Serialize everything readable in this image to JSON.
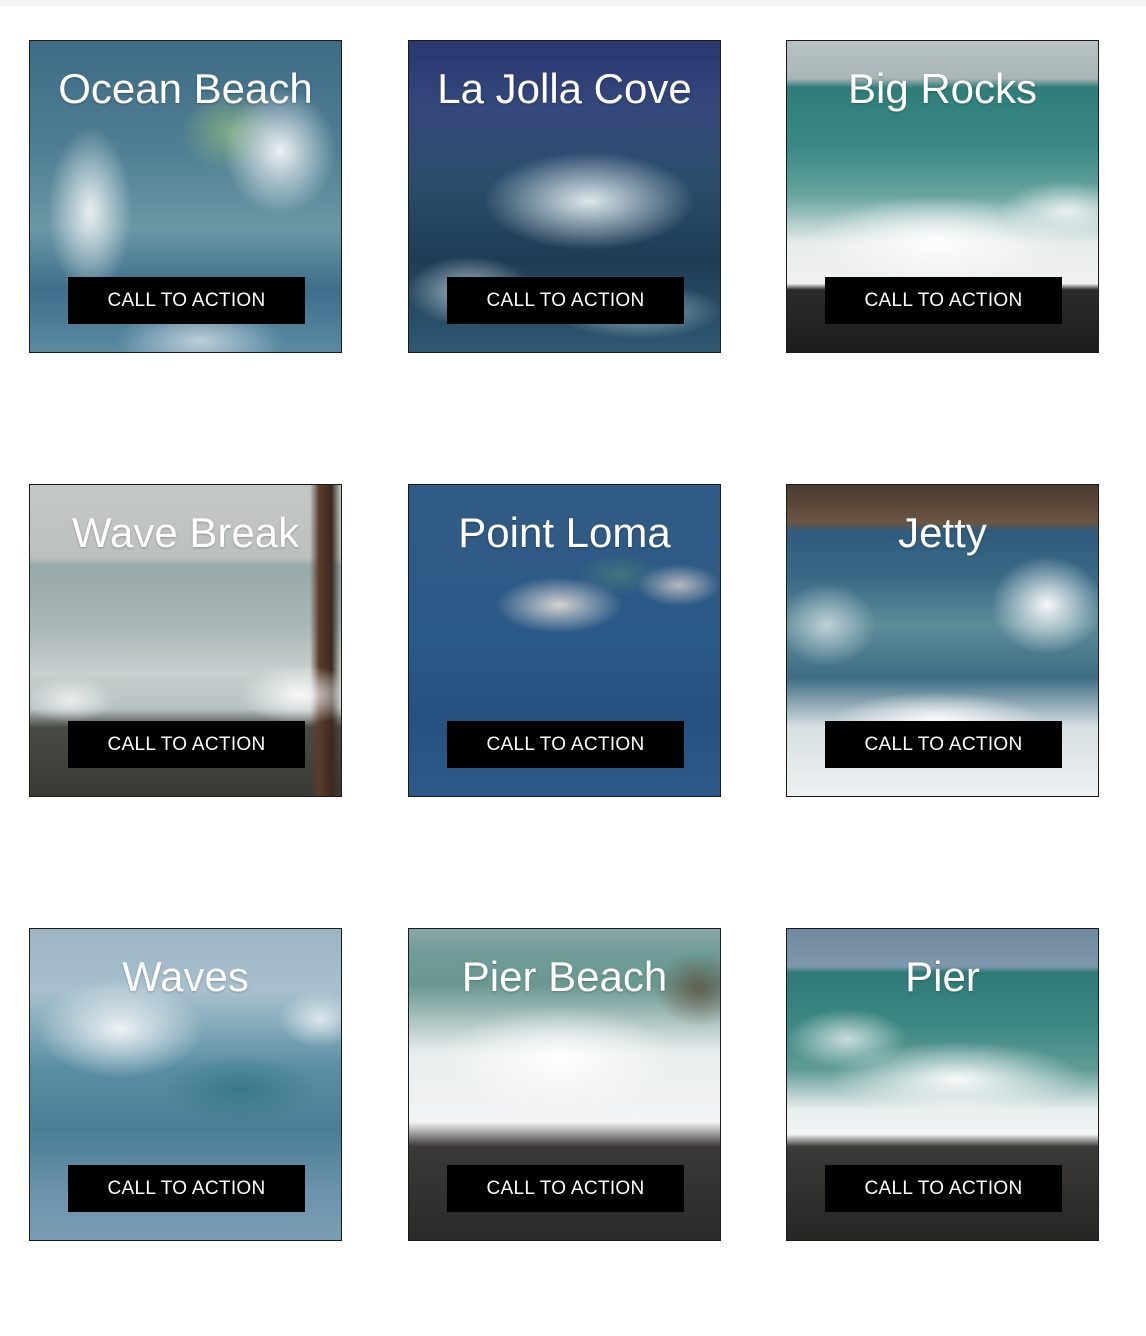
{
  "cards": [
    {
      "title": "Ocean Beach",
      "cta": "CALL TO ACTION"
    },
    {
      "title": "La Jolla Cove",
      "cta": "CALL TO ACTION"
    },
    {
      "title": "Big Rocks",
      "cta": "CALL TO ACTION"
    },
    {
      "title": "Wave Break",
      "cta": "CALL TO ACTION"
    },
    {
      "title": "Point Loma",
      "cta": "CALL TO ACTION"
    },
    {
      "title": "Jetty",
      "cta": "CALL TO ACTION"
    },
    {
      "title": "Waves",
      "cta": "CALL TO ACTION"
    },
    {
      "title": "Pier Beach",
      "cta": "CALL TO ACTION"
    },
    {
      "title": "Pier",
      "cta": "CALL TO ACTION"
    }
  ],
  "colors": {
    "background": "#ffffff",
    "button_bg": "#000000",
    "button_text": "#ffffff",
    "title_text": "#ffffff"
  }
}
